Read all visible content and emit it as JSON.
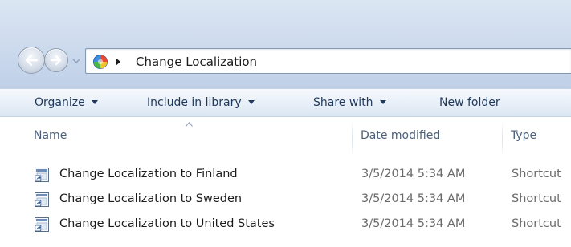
{
  "navigation": {
    "back_icon": "arrow-left-icon",
    "forward_icon": "arrow-right-icon",
    "history_icon": "chevron-down-icon"
  },
  "address_bar": {
    "location_icon": "control-panel-globe-icon",
    "separator_icon": "chevron-right-icon",
    "path": "Change Localization"
  },
  "command_bar": {
    "organize": "Organize",
    "include_in_library": "Include in library",
    "share_with": "Share with",
    "new_folder": "New folder"
  },
  "columns": {
    "name": "Name",
    "date_modified": "Date modified",
    "type": "Type",
    "sorted_by": "Name"
  },
  "files": [
    {
      "name": "Change Localization to Finland",
      "date_modified": "3/5/2014 5:34 AM",
      "type": "Shortcut",
      "icon": "shortcut-icon"
    },
    {
      "name": "Change Localization to Sweden",
      "date_modified": "3/5/2014 5:34 AM",
      "type": "Shortcut",
      "icon": "shortcut-icon"
    },
    {
      "name": "Change Localization to United States",
      "date_modified": "3/5/2014 5:34 AM",
      "type": "Shortcut",
      "icon": "shortcut-icon"
    }
  ],
  "colors": {
    "chrome_top": "#dbe6f3",
    "command_text": "#1e395b",
    "header_text": "#4c607a",
    "secondary_text": "#6a6a6a"
  }
}
